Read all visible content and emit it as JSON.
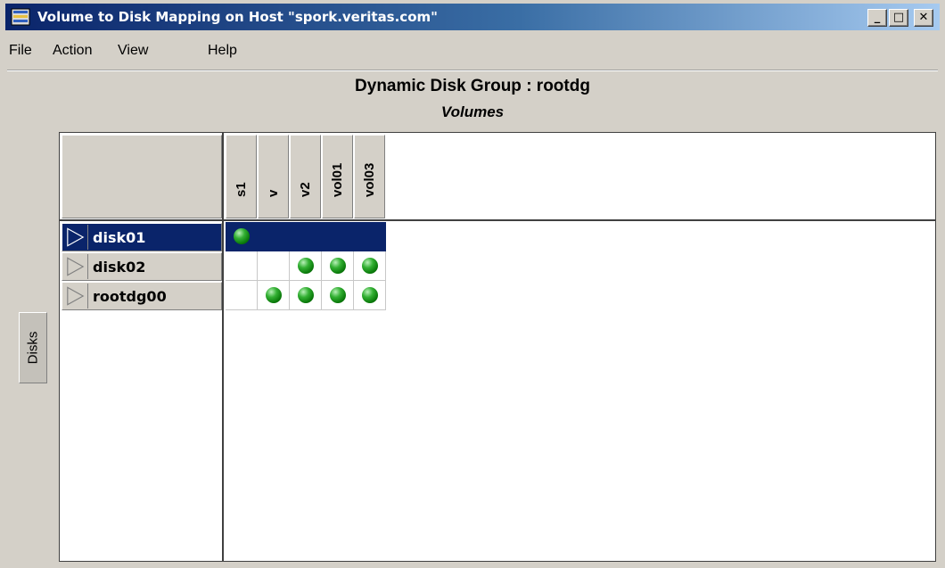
{
  "window": {
    "title": "Volume to Disk Mapping on Host \"spork.veritas.com\"",
    "controls": {
      "minimize": "_",
      "maximize": "□",
      "close": "✕"
    }
  },
  "menu": [
    "File",
    "Action",
    "View",
    "Help"
  ],
  "group_title": "Dynamic Disk Group : rootdg",
  "volumes_title": "Volumes",
  "disks_tab": "Disks",
  "volumes": [
    "s1",
    "v",
    "v2",
    "vol01",
    "vol03"
  ],
  "disks": [
    {
      "name": "disk01",
      "selected": true
    },
    {
      "name": "disk02",
      "selected": false
    },
    {
      "name": "rootdg00",
      "selected": false
    }
  ],
  "mapping": [
    [
      true,
      false,
      false,
      false,
      false
    ],
    [
      false,
      false,
      true,
      true,
      true
    ],
    [
      false,
      true,
      true,
      true,
      true
    ]
  ],
  "colors": {
    "selection": "#0a246a",
    "mapped_dot": "#2aa52a",
    "titlebar_start": "#0a246a",
    "titlebar_end": "#a6caf0"
  }
}
